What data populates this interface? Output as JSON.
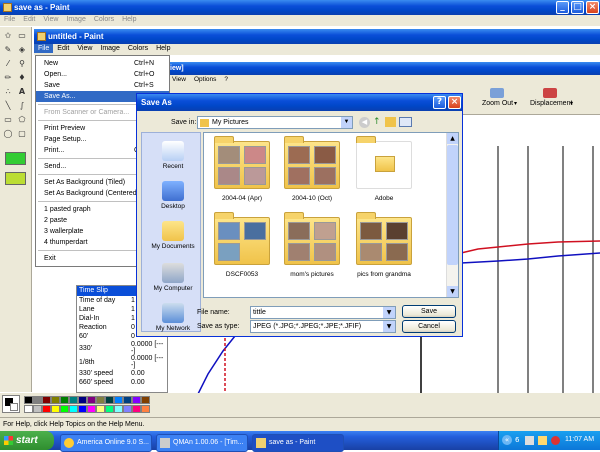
{
  "outer": {
    "title": "save as - Paint",
    "menu": [
      "File",
      "Edit",
      "View",
      "Image",
      "Colors",
      "Help"
    ]
  },
  "inner": {
    "title": "untitled - Paint",
    "menu": [
      "File",
      "Edit",
      "View",
      "Image",
      "Colors",
      "Help"
    ]
  },
  "background_app": {
    "title_fragment": "iew]",
    "menu": [
      "View",
      "Options",
      "?"
    ],
    "toolbar": [
      "Zoom Out",
      "Displacement"
    ]
  },
  "file_menu": {
    "groups": [
      [
        {
          "label": "New",
          "shortcut": "Ctrl+N"
        },
        {
          "label": "Open...",
          "shortcut": "Ctrl+O"
        },
        {
          "label": "Save",
          "shortcut": "Ctrl+S"
        },
        {
          "label": "Save As...",
          "shortcut": "",
          "highlighted": true
        }
      ],
      [
        {
          "label": "From Scanner or Camera...",
          "shortcut": "",
          "disabled": true
        }
      ],
      [
        {
          "label": "Print Preview"
        },
        {
          "label": "Page Setup..."
        },
        {
          "label": "Print...",
          "shortcut": "Ctrl+P"
        }
      ],
      [
        {
          "label": "Send..."
        }
      ],
      [
        {
          "label": "Set As Background (Tiled)"
        },
        {
          "label": "Set As Background (Centered)"
        }
      ],
      [
        {
          "label": "1 pasted graph"
        },
        {
          "label": "2 paste"
        },
        {
          "label": "3 wallerplate"
        },
        {
          "label": "4 thumperdart"
        }
      ],
      [
        {
          "label": "Exit"
        }
      ]
    ]
  },
  "dialog": {
    "title": "Save As",
    "help_btn": "?",
    "close_btn": "×",
    "save_in_label": "Save in:",
    "save_in_value": "My Pictures",
    "places": [
      "Recent",
      "Desktop",
      "My Documents",
      "My Computer",
      "My Network"
    ],
    "folders": [
      "2004-04 (Apr)",
      "2004-10 (Oct)",
      "Adobe",
      "DSCF0053",
      "mom's pictures",
      "pics from grandma"
    ],
    "filename_label": "File name:",
    "filename_value": "tittle",
    "savetype_label": "Save as type:",
    "savetype_value": "JPEG (*.JPG;*.JPEG;*.JPE;*.JFIF)",
    "save_btn": "Save",
    "cancel_btn": "Cancel"
  },
  "time_slip": {
    "title": "Time Slip",
    "rows": [
      {
        "label": "Time of day",
        "value": "1"
      },
      {
        "label": "Lane",
        "value": "1"
      },
      {
        "label": "Dial-In",
        "value": "1"
      },
      {
        "label": "Reaction",
        "value": "0"
      },
      {
        "label": "60'",
        "value": "0"
      },
      {
        "label": "330'",
        "value": "0.0000  [----]"
      },
      {
        "label": "1/8th",
        "value": "0.0000  [----]"
      },
      {
        "label": "330' speed",
        "value": "0.00"
      },
      {
        "label": "660' speed",
        "value": "0.00"
      }
    ]
  },
  "palette": [
    "#000000",
    "#808080",
    "#800000",
    "#808000",
    "#008000",
    "#008080",
    "#000080",
    "#800080",
    "#808040",
    "#004040",
    "#0080ff",
    "#004080",
    "#8000ff",
    "#804000",
    "#ffffff",
    "#c0c0c0",
    "#ff0000",
    "#ffff00",
    "#00ff00",
    "#00ffff",
    "#0000ff",
    "#ff00ff",
    "#ffff80",
    "#00ff80",
    "#80ffff",
    "#8080ff",
    "#ff0080",
    "#ff8040"
  ],
  "status_text": "For Help, click Help Topics on the Help Menu.",
  "taskbar": {
    "start": "start",
    "items": [
      "America Online 9.0 S...",
      "QMAn 1.00.06 - [Tim...",
      "save as - Paint"
    ],
    "clock": "11:07 AM",
    "tray_count": "6"
  },
  "accent": "#0a4ed8",
  "graph_colors": {
    "red": "#d01020",
    "blue": "#1010c0"
  }
}
